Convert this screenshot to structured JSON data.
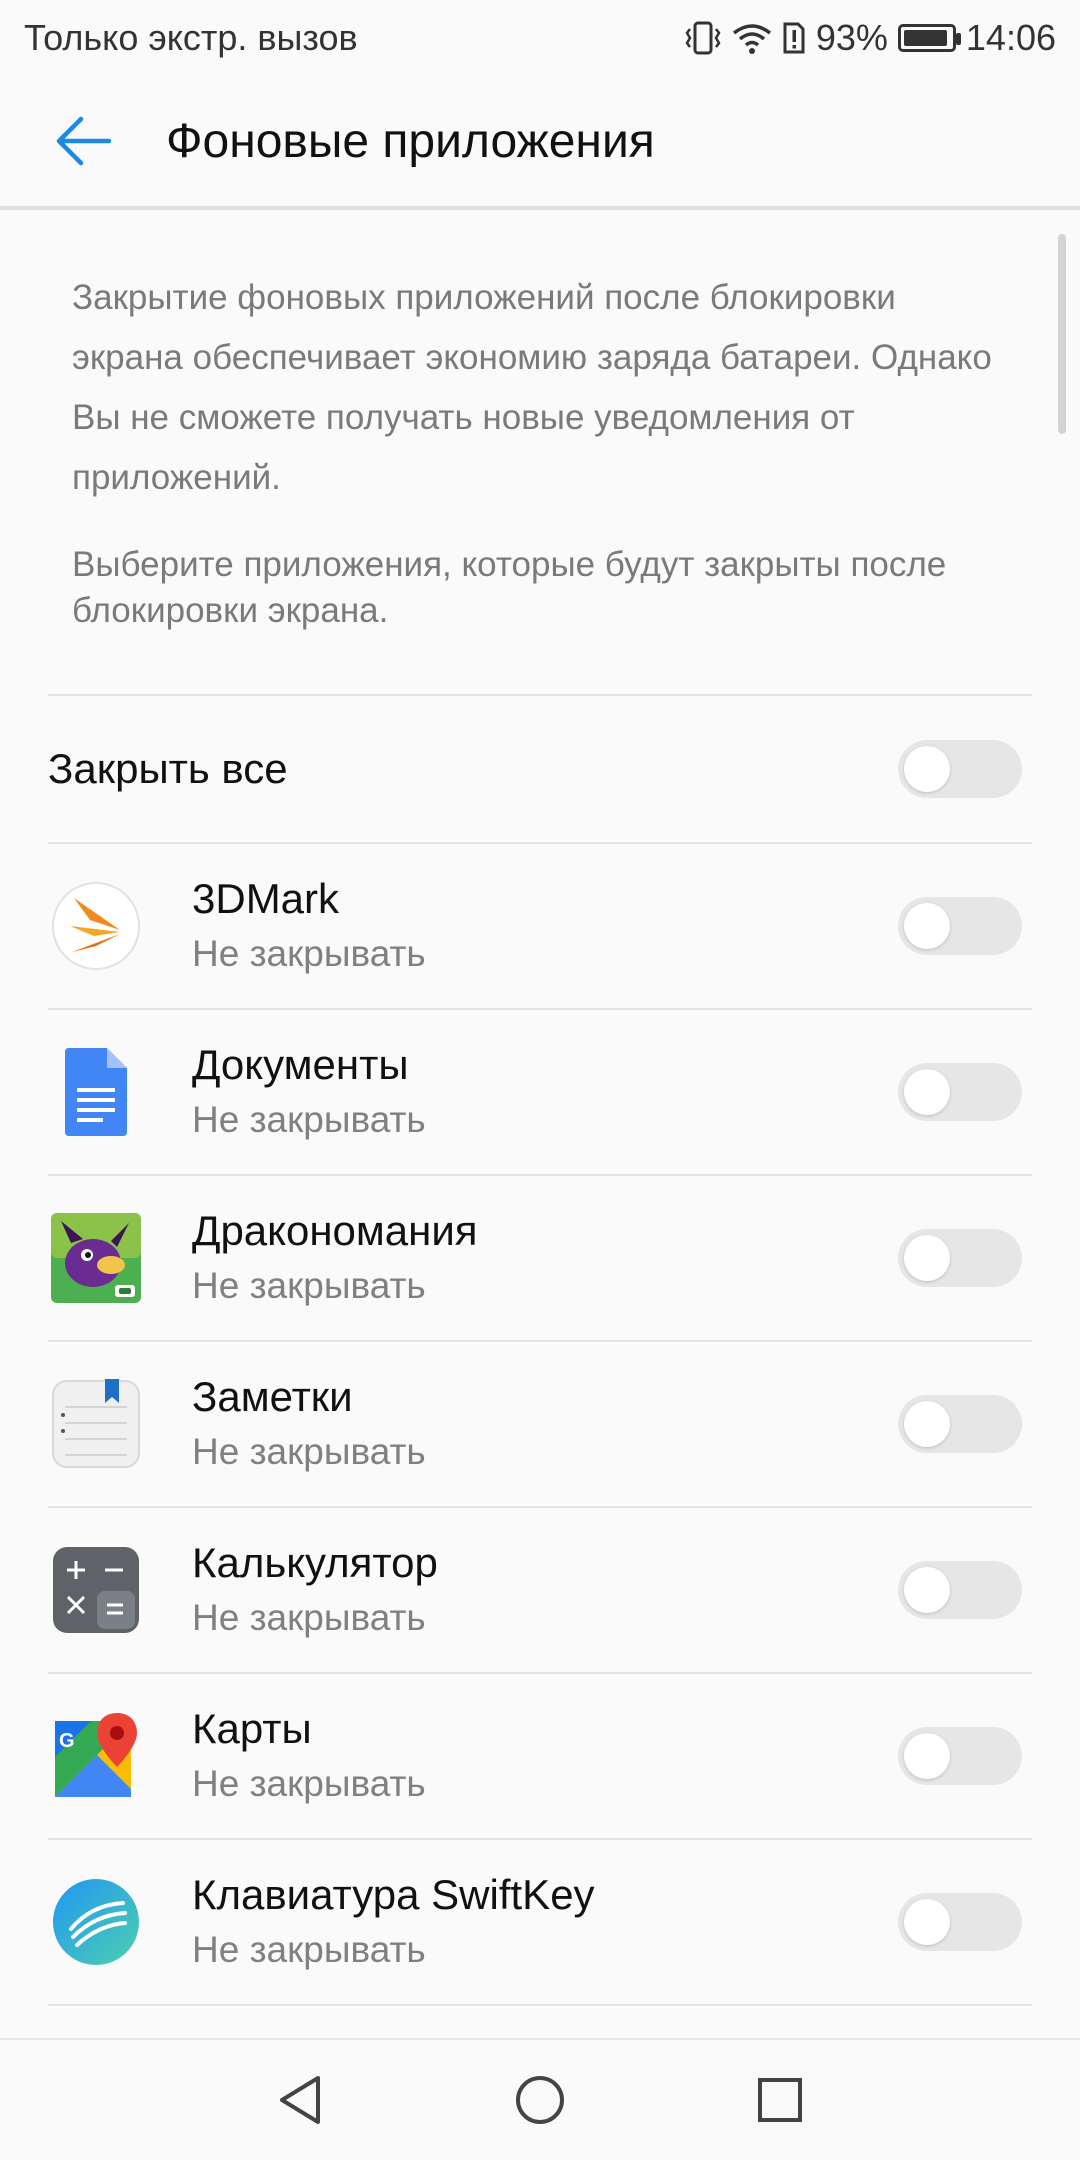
{
  "status_bar": {
    "carrier_text": "Только экстр. вызов",
    "battery_percent": "93%",
    "battery_level": 0.93,
    "time": "14:06",
    "icons": [
      "vibrate-icon",
      "wifi-icon",
      "alert-icon",
      "battery-icon"
    ]
  },
  "app_bar": {
    "title": "Фоновые приложения",
    "back_icon": "arrow-left-icon",
    "accent_color": "#1e88e5"
  },
  "description": {
    "paragraph1": "Закрытие фоновых приложений после блокировки экрана обеспечивает экономию заряда батареи. Однако Вы не сможете получать новые уведомления от приложений.",
    "paragraph2": "Выберите приложения, которые будут закрыты после блокировки экрана."
  },
  "close_all": {
    "label": "Закрыть все",
    "enabled": false
  },
  "apps": [
    {
      "name": "3DMark",
      "status": "Не закрывать",
      "icon": "3dmark-icon",
      "enabled": false
    },
    {
      "name": "Документы",
      "status": "Не закрывать",
      "icon": "google-docs-icon",
      "enabled": false
    },
    {
      "name": "Дракономания",
      "status": "Не закрывать",
      "icon": "dragon-game-icon",
      "enabled": false
    },
    {
      "name": "Заметки",
      "status": "Не закрывать",
      "icon": "notes-icon",
      "enabled": false
    },
    {
      "name": "Калькулятор",
      "status": "Не закрывать",
      "icon": "calculator-icon",
      "enabled": false
    },
    {
      "name": "Карты",
      "status": "Не закрывать",
      "icon": "google-maps-icon",
      "enabled": false
    },
    {
      "name": "Клавиатура SwiftKey",
      "status": "Не закрывать",
      "icon": "swiftkey-icon",
      "enabled": false
    }
  ],
  "nav_bar": {
    "buttons": [
      "back-triangle-icon",
      "home-circle-icon",
      "recents-square-icon"
    ]
  }
}
